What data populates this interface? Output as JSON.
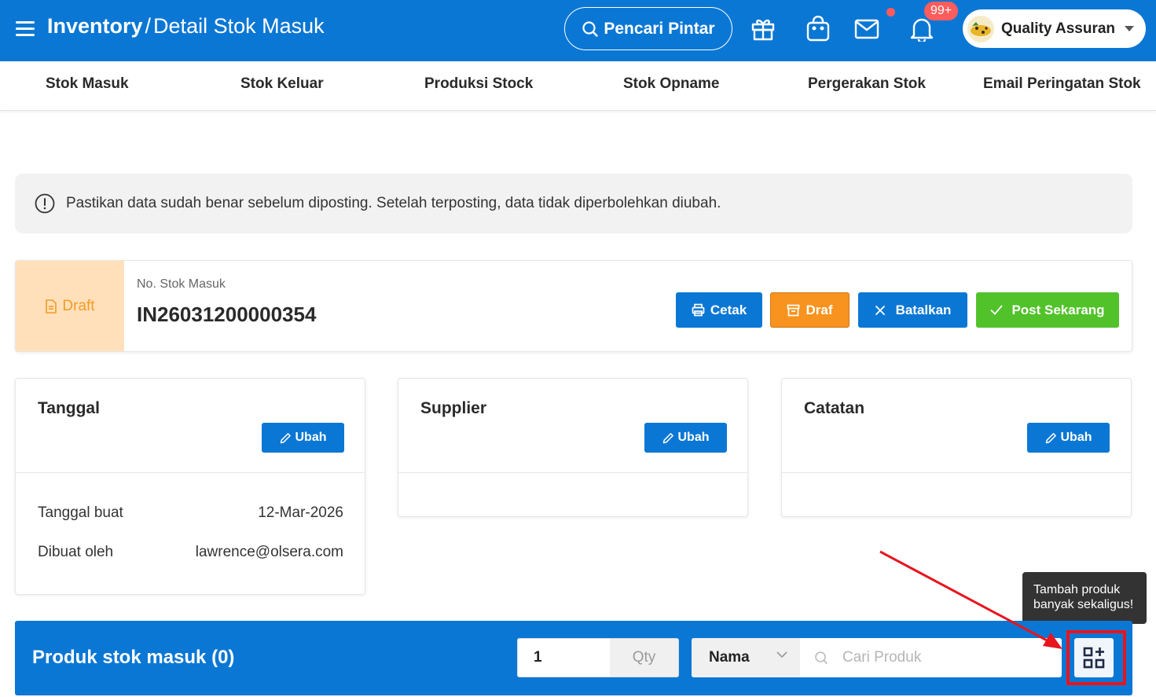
{
  "header": {
    "breadcrumb_root": "Inventory",
    "breadcrumb_sep": "/",
    "breadcrumb_page": "Detail Stok Masuk",
    "smart_search_label": "Pencari Pintar",
    "notification_count": "99+",
    "profile_name": "Quality Assuran"
  },
  "subnav": {
    "items": [
      "Stok Masuk",
      "Stok Keluar",
      "Produksi Stock",
      "Stok Opname",
      "Pergerakan Stok",
      "Email Peringatan Stok"
    ]
  },
  "alert": {
    "text": "Pastikan data sudah benar sebelum diposting. Setelah terposting, data tidak diperbolehkan diubah."
  },
  "document": {
    "status": "Draft",
    "number_label": "No. Stok Masuk",
    "number_value": "IN26031200000354",
    "actions": {
      "print": "Cetak",
      "draft": "Draf",
      "cancel": "Batalkan",
      "post": "Post Sekarang"
    }
  },
  "cards": {
    "date": {
      "title": "Tanggal",
      "edit_label": "Ubah",
      "rows": [
        {
          "label": "Tanggal buat",
          "value": "12-Mar-2026"
        },
        {
          "label": "Dibuat oleh",
          "value": "lawrence@olsera.com"
        }
      ]
    },
    "supplier": {
      "title": "Supplier",
      "edit_label": "Ubah"
    },
    "notes": {
      "title": "Catatan",
      "edit_label": "Ubah"
    }
  },
  "products": {
    "title": "Produk stok masuk (0)",
    "qty_value": "1",
    "qty_unit": "Qty",
    "search_by": "Nama",
    "search_placeholder": "Cari Produk"
  },
  "tooltip": {
    "line1": "Tambah produk",
    "line2": "banyak sekaligus!"
  },
  "colors": {
    "primary": "#0b77d4",
    "draft_bg": "#ffe0bb",
    "draft_text": "#f59a23",
    "orange": "#f7931e",
    "green": "#52c22b",
    "highlight": "#e8141d",
    "badge": "#ff5d5d"
  },
  "icons": {
    "menu": "hamburger-icon",
    "search": "search-icon",
    "gift": "gift-icon",
    "shop": "shopping-bag-icon",
    "mail": "mail-icon",
    "bell": "bell-icon",
    "info": "info-circle-icon",
    "print": "printer-icon",
    "archive": "archive-icon",
    "close": "close-icon",
    "check": "check-icon",
    "edit": "pencil-icon",
    "grid_add": "grid-plus-icon"
  }
}
